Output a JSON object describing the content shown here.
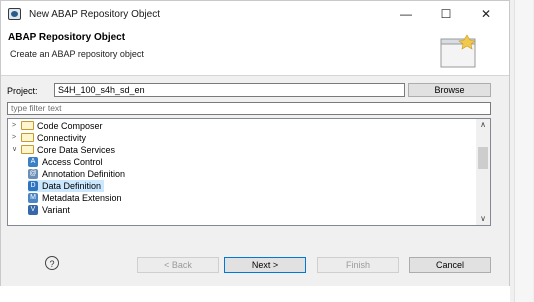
{
  "window": {
    "title": "New ABAP Repository Object",
    "minimize": "—",
    "maximize": "☐",
    "close": "✕"
  },
  "header": {
    "title": "ABAP Repository Object",
    "subtitle": "Create an ABAP repository object"
  },
  "project": {
    "label": "Project:",
    "value": "S4H_100_s4h_sd_en",
    "browse": "Browse"
  },
  "filter": {
    "placeholder": "type filter text"
  },
  "tree": {
    "folders": [
      {
        "label": "Code Composer",
        "expanded": false
      },
      {
        "label": "Connectivity",
        "expanded": false
      },
      {
        "label": "Core Data Services",
        "expanded": true
      }
    ],
    "children": [
      {
        "label": "Access Control",
        "icon": "access-control-icon",
        "color": "#3b7fc4",
        "glyph": "A"
      },
      {
        "label": "Annotation Definition",
        "icon": "annotation-definition-icon",
        "color": "#6a8fb8",
        "glyph": "@"
      },
      {
        "label": "Data Definition",
        "icon": "data-definition-icon",
        "color": "#2f74c0",
        "glyph": "D",
        "selected": true
      },
      {
        "label": "Metadata Extension",
        "icon": "metadata-extension-icon",
        "color": "#4a86c5",
        "glyph": "M"
      },
      {
        "label": "Variant",
        "icon": "variant-icon",
        "color": "#3568a8",
        "glyph": "V"
      }
    ]
  },
  "footer": {
    "help": "?",
    "back": "< Back",
    "next": "Next >",
    "finish": "Finish",
    "cancel": "Cancel"
  }
}
